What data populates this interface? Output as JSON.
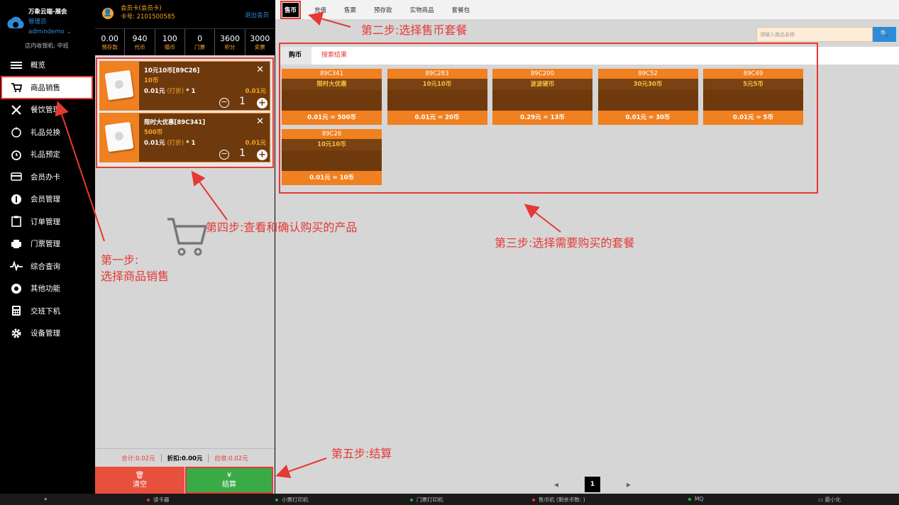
{
  "brand": {
    "title": "万象云端-展会",
    "role": "管理员",
    "user": "admindemo ⌄",
    "cashier": "店内收银机: 中班"
  },
  "nav": [
    {
      "label": "概览",
      "icon": "menu-icon"
    },
    {
      "label": "商品销售",
      "icon": "cart-icon",
      "active": true
    },
    {
      "label": "餐饮管理",
      "icon": "utensils-icon"
    },
    {
      "label": "礼品兑换",
      "icon": "gift-icon"
    },
    {
      "label": "礼品预定",
      "icon": "clock-icon"
    },
    {
      "label": "会员办卡",
      "icon": "card-icon"
    },
    {
      "label": "会员管理",
      "icon": "user-icon"
    },
    {
      "label": "订单管理",
      "icon": "clipboard-icon"
    },
    {
      "label": "门票管理",
      "icon": "printer-icon"
    },
    {
      "label": "综合查询",
      "icon": "pulse-icon"
    },
    {
      "label": "其他功能",
      "icon": "dial-icon"
    },
    {
      "label": "交班下机",
      "icon": "calculator-icon"
    },
    {
      "label": "设备管理",
      "icon": "gear-icon"
    }
  ],
  "member": {
    "type": "会员卡(会员卡)",
    "card_no": "卡号: 2101500585",
    "logout": "退出会员"
  },
  "stats": [
    {
      "value": "0.00",
      "label": "预存款"
    },
    {
      "value": "940",
      "label": "代币"
    },
    {
      "value": "100",
      "label": "赠币"
    },
    {
      "value": "0",
      "label": "门票"
    },
    {
      "value": "3600",
      "label": "积分"
    },
    {
      "value": "3000",
      "label": "奖票"
    }
  ],
  "cart_items": [
    {
      "name": "10元10币[89C26]",
      "coins": "10币",
      "price": "0.01元",
      "discount": "(打折)",
      "mult": "* 1",
      "total": "0.01元",
      "qty": "1"
    },
    {
      "name": "限时大优惠[89C341]",
      "coins": "500币",
      "price": "0.01元",
      "discount": "(打折)",
      "mult": "* 1",
      "total": "0.01元",
      "qty": "1"
    }
  ],
  "totals": {
    "sum": "合计:0.02元",
    "discount": "折扣:0.00元",
    "due": "应收:0.02元"
  },
  "buttons": {
    "clear_icon": "🗑",
    "clear": "清空",
    "pay_icon": "¥",
    "pay": "结算"
  },
  "tabs": [
    "售币",
    "充值",
    "售票",
    "预存款",
    "实物商品",
    "套餐包"
  ],
  "search": {
    "placeholder": "请输入商品名称",
    "button": "🔍"
  },
  "subtabs": [
    "购币",
    "搜索结果"
  ],
  "products": [
    {
      "code": "89C341",
      "title": "限时大优惠",
      "price": "0.01元 = 500币"
    },
    {
      "code": "89C283",
      "title": "10元10币",
      "price": "0.01元 = 20币"
    },
    {
      "code": "89C200",
      "title": "波波硬币",
      "price": "0.29元 = 13币"
    },
    {
      "code": "89C52",
      "title": "30元30币",
      "price": "0.01元 = 30币"
    },
    {
      "code": "89C49",
      "title": "5元5币",
      "price": "0.01元 = 5币"
    },
    {
      "code": "89C26",
      "title": "10元10币",
      "price": "0.01元 = 10币"
    }
  ],
  "pager": {
    "prev": "◀",
    "current": "1",
    "next": "▶"
  },
  "status": {
    "collapse": "«",
    "items": [
      {
        "label": "读卡器",
        "color": "#e53935"
      },
      {
        "label": "小票打印机",
        "color": "#3aaa47"
      },
      {
        "label": "门票打印机",
        "color": "#3aaa47"
      },
      {
        "label": "售币机 (剩余币数: )",
        "color": "#e53935"
      },
      {
        "label": "MQ",
        "color": "#3aaa47"
      }
    ],
    "minimize": "最小化"
  },
  "annotations": {
    "step1_a": "第一步:",
    "step1_b": "选择商品销售",
    "step2": "第二步:选择售币套餐",
    "step3": "第三步:选择需要购买的套餐",
    "step4": "第四步:查看和确认购买的产品",
    "step5": "第五步:结算"
  },
  "colors": {
    "accent": "#e53935",
    "orange": "#f08020",
    "brown": "#6e3a0d",
    "green": "#3aaa47",
    "blue": "#2e8bd8"
  }
}
